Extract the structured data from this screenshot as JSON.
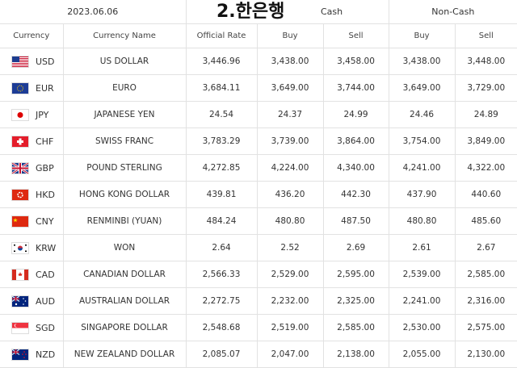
{
  "title": "2.한은행",
  "header": {
    "date": "2023.06.06",
    "cash": "Cash",
    "noncash": "Non-Cash",
    "columns": [
      "Currency",
      "Currency Name",
      "Official Rate",
      "Buy",
      "Sell",
      "Buy",
      "Sell"
    ]
  },
  "rows": [
    {
      "code": "USD",
      "flag_icon": "us-flag-icon",
      "name": "US DOLLAR",
      "official": "3,446.96",
      "cash_buy": "3,438.00",
      "cash_sell": "3,458.00",
      "nc_buy": "3,438.00",
      "nc_sell": "3,448.00"
    },
    {
      "code": "EUR",
      "flag_icon": "eu-flag-icon",
      "name": "EURO",
      "official": "3,684.11",
      "cash_buy": "3,649.00",
      "cash_sell": "3,744.00",
      "nc_buy": "3,649.00",
      "nc_sell": "3,729.00"
    },
    {
      "code": "JPY",
      "flag_icon": "jp-flag-icon",
      "name": "JAPANESE YEN",
      "official": "24.54",
      "cash_buy": "24.37",
      "cash_sell": "24.99",
      "nc_buy": "24.46",
      "nc_sell": "24.89"
    },
    {
      "code": "CHF",
      "flag_icon": "ch-flag-icon",
      "name": "SWISS FRANC",
      "official": "3,783.29",
      "cash_buy": "3,739.00",
      "cash_sell": "3,864.00",
      "nc_buy": "3,754.00",
      "nc_sell": "3,849.00"
    },
    {
      "code": "GBP",
      "flag_icon": "gb-flag-icon",
      "name": "POUND STERLING",
      "official": "4,272.85",
      "cash_buy": "4,224.00",
      "cash_sell": "4,340.00",
      "nc_buy": "4,241.00",
      "nc_sell": "4,322.00"
    },
    {
      "code": "HKD",
      "flag_icon": "hk-flag-icon",
      "name": "HONG KONG DOLLAR",
      "official": "439.81",
      "cash_buy": "436.20",
      "cash_sell": "442.30",
      "nc_buy": "437.90",
      "nc_sell": "440.60"
    },
    {
      "code": "CNY",
      "flag_icon": "cn-flag-icon",
      "name": "RENMINBI (YUAN)",
      "official": "484.24",
      "cash_buy": "480.80",
      "cash_sell": "487.50",
      "nc_buy": "480.80",
      "nc_sell": "485.60"
    },
    {
      "code": "KRW",
      "flag_icon": "kr-flag-icon",
      "name": "WON",
      "official": "2.64",
      "cash_buy": "2.52",
      "cash_sell": "2.69",
      "nc_buy": "2.61",
      "nc_sell": "2.67"
    },
    {
      "code": "CAD",
      "flag_icon": "ca-flag-icon",
      "name": "CANADIAN DOLLAR",
      "official": "2,566.33",
      "cash_buy": "2,529.00",
      "cash_sell": "2,595.00",
      "nc_buy": "2,539.00",
      "nc_sell": "2,585.00"
    },
    {
      "code": "AUD",
      "flag_icon": "au-flag-icon",
      "name": "AUSTRALIAN DOLLAR",
      "official": "2,272.75",
      "cash_buy": "2,232.00",
      "cash_sell": "2,325.00",
      "nc_buy": "2,241.00",
      "nc_sell": "2,316.00"
    },
    {
      "code": "SGD",
      "flag_icon": "sg-flag-icon",
      "name": "SINGAPORE DOLLAR",
      "official": "2,548.68",
      "cash_buy": "2,519.00",
      "cash_sell": "2,585.00",
      "nc_buy": "2,530.00",
      "nc_sell": "2,575.00"
    },
    {
      "code": "NZD",
      "flag_icon": "nz-flag-icon",
      "name": "NEW ZEALAND DOLLAR",
      "official": "2,085.07",
      "cash_buy": "2,047.00",
      "cash_sell": "2,138.00",
      "nc_buy": "2,055.00",
      "nc_sell": "2,130.00"
    }
  ]
}
